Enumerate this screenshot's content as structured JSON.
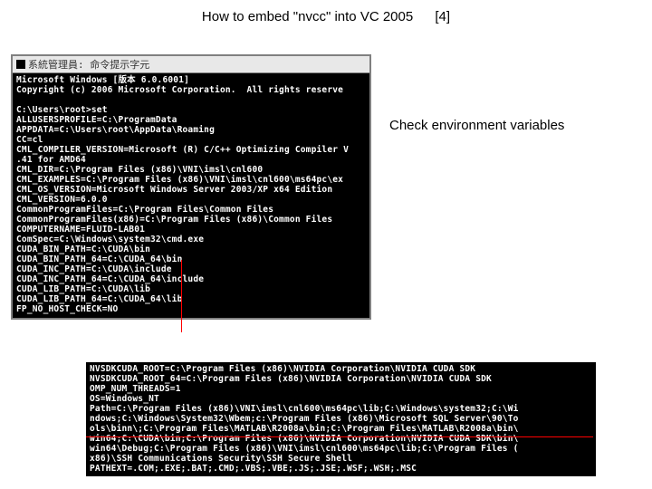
{
  "title": {
    "text": "How to embed \"nvcc\" into VC 2005",
    "index": "[4]"
  },
  "annotation": "Check environment variables",
  "term1": {
    "window_title": "系統管理員: 命令提示字元",
    "lines": [
      "Microsoft Windows [版本 6.0.6001]",
      "Copyright (c) 2006 Microsoft Corporation.  All rights reserve",
      "",
      "C:\\Users\\root>set",
      "ALLUSERSPROFILE=C:\\ProgramData",
      "APPDATA=C:\\Users\\root\\AppData\\Roaming",
      "CC=cl",
      "CML_COMPILER_VERSION=Microsoft (R) C/C++ Optimizing Compiler V",
      ".41 for AMD64",
      "CML_DIR=C:\\Program Files (x86)\\VNI\\imsl\\cnl600",
      "CML_EXAMPLES=C:\\Program Files (x86)\\VNI\\imsl\\cnl600\\ms64pc\\ex",
      "CML_OS_VERSION=Microsoft Windows Server 2003/XP x64 Edition",
      "CML_VERSION=6.0.0",
      "CommonProgramFiles=C:\\Program Files\\Common Files",
      "CommonProgramFiles(x86)=C:\\Program Files (x86)\\Common Files",
      "COMPUTERNAME=FLUID-LAB01",
      "ComSpec=C:\\Windows\\system32\\cmd.exe",
      "CUDA_BIN_PATH=C:\\CUDA\\bin",
      "CUDA_BIN_PATH_64=C:\\CUDA_64\\bin",
      "CUDA_INC_PATH=C:\\CUDA\\include",
      "CUDA_INC_PATH_64=C:\\CUDA_64\\include",
      "CUDA_LIB_PATH=C:\\CUDA\\lib",
      "CUDA_LIB_PATH_64=C:\\CUDA_64\\lib",
      "FP_NO_HOST_CHECK=NO",
      ""
    ]
  },
  "term2": {
    "lines": [
      "NVSDKCUDA_ROOT=C:\\Program Files (x86)\\NVIDIA Corporation\\NVIDIA CUDA SDK",
      "NVSDKCUDA_ROOT_64=C:\\Program Files (x86)\\NVIDIA Corporation\\NVIDIA CUDA SDK",
      "OMP_NUM_THREADS=1",
      "OS=Windows_NT",
      "Path=C:\\Program Files (x86)\\VNI\\imsl\\cnl600\\ms64pc\\lib;C:\\Windows\\system32;C:\\Wi",
      "ndows;C:\\Windows\\System32\\Wbem;c:\\Program Files (x86)\\Microsoft SQL Server\\90\\To",
      "ols\\binn\\;C:\\Program Files\\MATLAB\\R2008a\\bin;C:\\Program Files\\MATLAB\\R2008a\\bin\\",
      "win64;C:\\CUDA\\bin;C:\\Program Files (x86)\\NVIDIA Corporation\\NVIDIA CUDA SDK\\bin\\",
      "win64\\Debug;C:\\Program Files (x86)\\VNI\\imsl\\cnl600\\ms64pc\\lib;C:\\Program Files (",
      "x86)\\SSH Communications Security\\SSH Secure Shell",
      "PATHEXT=.COM;.EXE;.BAT;.CMD;.VBS;.VBE;.JS;.JSE;.WSF;.WSH;.MSC"
    ]
  }
}
